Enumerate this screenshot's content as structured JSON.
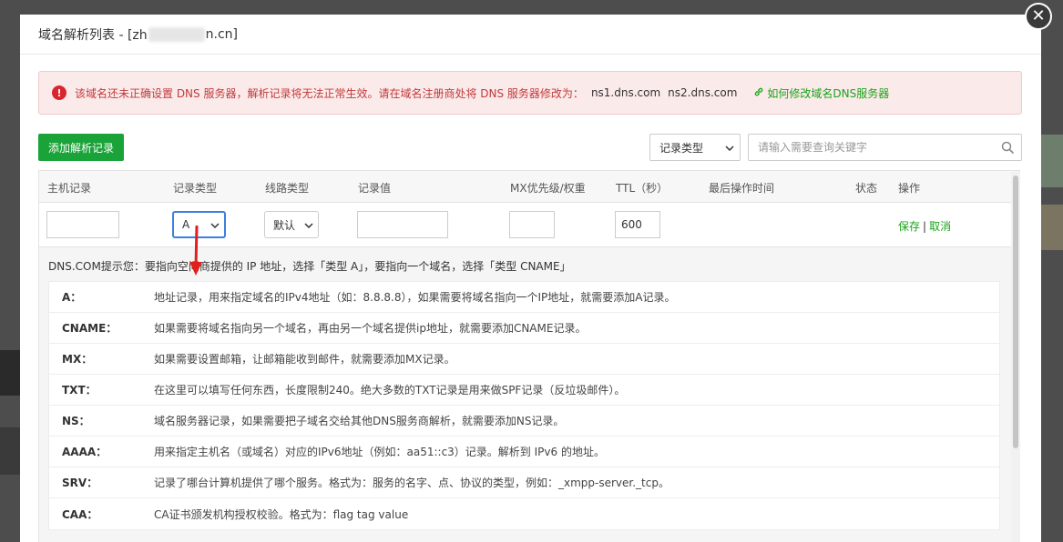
{
  "modal": {
    "title_prefix": "域名解析列表 - [zh",
    "title_suffix": "n.cn]",
    "close_glyph": "✕"
  },
  "alert": {
    "icon_glyph": "!",
    "message": "该域名还未正确设置 DNS 服务器，解析记录将无法正常生效。请在域名注册商处将 DNS 服务器修改为：",
    "ns1": "ns1.dns.com",
    "ns2": "ns2.dns.com",
    "link_icon": "link-icon",
    "link_text": "如何修改域名DNS服务器"
  },
  "toolbar": {
    "add_label": "添加解析记录",
    "type_select_value": "记录类型",
    "search_placeholder": "请输入需要查询关键字"
  },
  "table": {
    "headers": {
      "host": "主机记录",
      "type": "记录类型",
      "line": "线路类型",
      "value": "记录值",
      "mx": "MX优先级/权重",
      "ttl": "TTL（秒）",
      "last_op": "最后操作时间",
      "status": "状态",
      "ops": "操作"
    },
    "edit_row": {
      "host_value": "",
      "type_value": "A",
      "line_value": "默认",
      "record_value": "",
      "mx_value": "",
      "ttl_value": "600",
      "save_label": "保存",
      "separator": "|",
      "cancel_label": "取消"
    }
  },
  "tips": {
    "title": "DNS.COM提示您：要指向空间商提供的 IP 地址，选择「类型 A」，要指向一个域名，选择「类型 CNAME」",
    "items": [
      {
        "key": "A：",
        "desc": "地址记录，用来指定域名的IPv4地址（如：8.8.8.8），如果需要将域名指向一个IP地址，就需要添加A记录。"
      },
      {
        "key": "CNAME：",
        "desc": "如果需要将域名指向另一个域名，再由另一个域名提供ip地址，就需要添加CNAME记录。"
      },
      {
        "key": "MX：",
        "desc": "如果需要设置邮箱，让邮箱能收到邮件，就需要添加MX记录。"
      },
      {
        "key": "TXT：",
        "desc": "在这里可以填写任何东西，长度限制240。绝大多数的TXT记录是用来做SPF记录（反垃圾邮件）。"
      },
      {
        "key": "NS：",
        "desc": "域名服务器记录，如果需要把子域名交给其他DNS服务商解析，就需要添加NS记录。"
      },
      {
        "key": "AAAA：",
        "desc": "用来指定主机名（或域名）对应的IPv6地址（例如：aa51::c3）记录。解析到 IPv6 的地址。"
      },
      {
        "key": "SRV：",
        "desc": "记录了哪台计算机提供了哪个服务。格式为：服务的名字、点、协议的类型，例如：_xmpp-server._tcp。"
      },
      {
        "key": "CAA：",
        "desc": "CA证书颁发机构授权校验。格式为：flag tag value"
      }
    ]
  },
  "colors": {
    "brand_green": "#1aa338",
    "alert_red": "#d9262e",
    "focus_blue": "#3b7fe0",
    "annotation_red": "#e0201a"
  }
}
